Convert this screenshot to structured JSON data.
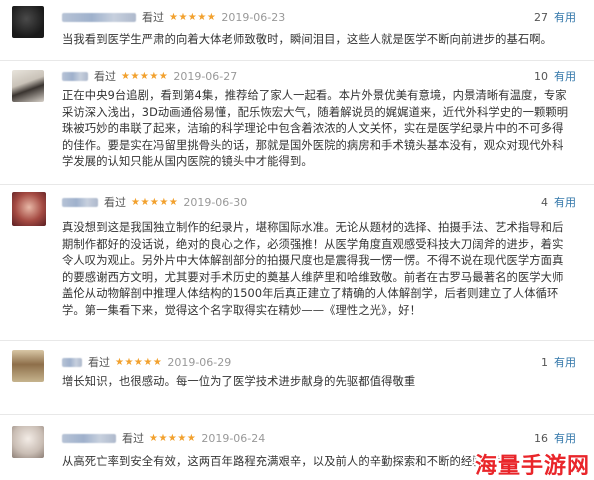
{
  "reviews": [
    {
      "seen_label": "看过",
      "stars": "★★★★★",
      "date": "2019-06-23",
      "votes": "27",
      "useful_label": "有用",
      "text": "当我看到医学生严肃的向着大体老师致敬时，瞬间泪目，这些人就是医学不断向前进步的基石啊。"
    },
    {
      "seen_label": "看过",
      "stars": "★★★★★",
      "date": "2019-06-27",
      "votes": "10",
      "useful_label": "有用",
      "text": "正在中央9台追剧，看到第4集，推荐给了家人一起看。本片外景优美有意境，内景清晰有温度，专家采访深入浅出，3D动画通俗易懂，配乐恢宏大气，随着解说员的娓娓道来，近代外科学史的一颗颗明珠被巧妙的串联了起来，洁瑜的科学理论中包含着浓浓的人文关怀，实在是医学纪录片中的不可多得的佳作。要是实在冯留里挑骨头的话，那就是国外医院的病房和手术镜头基本没有，观众对现代外科学发展的认知只能从国内医院的镜头中才能得到。"
    },
    {
      "seen_label": "看过",
      "stars": "★★★★★",
      "date": "2019-06-30",
      "votes": "4",
      "useful_label": "有用",
      "text": "真没想到这是我国独立制作的纪录片，堪称国际水准。无论从题材的选择、拍摄手法、艺术指导和后期制作都好的没话说，绝对的良心之作，必须强推！从医学角度直观感受科技大刀阔斧的进步，着实令人叹为观止。另外片中大体解剖部分的拍摄尺度也是震得我一愣一愣。不得不说在现代医学方面真的要感谢西方文明，尤其要对手术历史的奠基人维萨里和哈维致敬。前者在古罗马最著名的医学大师盖伦从动物解剖中推理人体结构的1500年后真正建立了精确的人体解剖学，后者则建立了人体循环学。第一集看下来，觉得这个名字取得实在精妙——《理性之光》，好！"
    },
    {
      "seen_label": "看过",
      "stars": "★★★★★",
      "date": "2019-06-29",
      "votes": "1",
      "useful_label": "有用",
      "text": "增长知识，也很感动。每一位为了医学技术进步献身的先驱都值得敬重"
    },
    {
      "seen_label": "看过",
      "stars": "★★★★★",
      "date": "2019-06-24",
      "votes": "16",
      "useful_label": "有用",
      "text": "从高死亡率到安全有效，这两百年路程充满艰辛，以及前人的辛勤探索和不断的经验总结"
    }
  ],
  "watermark": "海量手游网",
  "colors": {
    "stars": "#f2a12e",
    "useful_link": "#3377aa",
    "watermark": "#e9252a"
  }
}
